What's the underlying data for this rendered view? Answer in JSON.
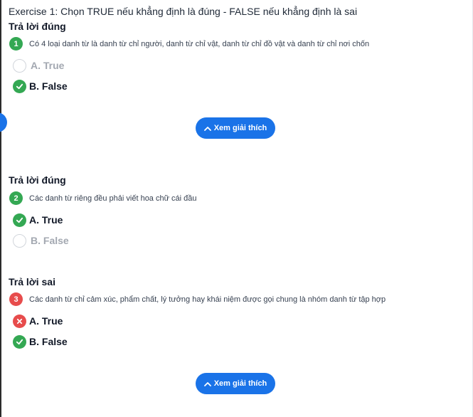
{
  "exercise_title": "Exercise 1: Chọn TRUE nếu khẳng định là đúng - FALSE nếu khẳng định là sai",
  "explain_label": "Xem giải thích",
  "colors": {
    "correct": "#34a853",
    "wrong": "#e74c4c",
    "accent": "#1a73e8"
  },
  "questions": [
    {
      "result": "Trả lời đúng",
      "number": "1",
      "text": "Có 4 loại danh từ là danh từ chỉ người, danh từ chỉ vật, danh từ chỉ đồ vật và danh từ chỉ nơi chốn",
      "options": [
        {
          "label": "A. True",
          "state": "unselected"
        },
        {
          "label": "B. False",
          "state": "correct"
        }
      ]
    },
    {
      "result": "Trả lời đúng",
      "number": "2",
      "text": "Các danh từ riêng đều phải viết hoa chữ cái đầu",
      "options": [
        {
          "label": "A. True",
          "state": "correct"
        },
        {
          "label": "B. False",
          "state": "unselected"
        }
      ]
    },
    {
      "result": "Trả lời sai",
      "number": "3",
      "text": "Các danh từ chỉ cảm xúc, phẩm chất, lý tưởng hay khái niệm được gọi chung là nhóm danh từ tập hợp",
      "options": [
        {
          "label": "A. True",
          "state": "wrong"
        },
        {
          "label": "B. False",
          "state": "correct"
        }
      ]
    }
  ]
}
